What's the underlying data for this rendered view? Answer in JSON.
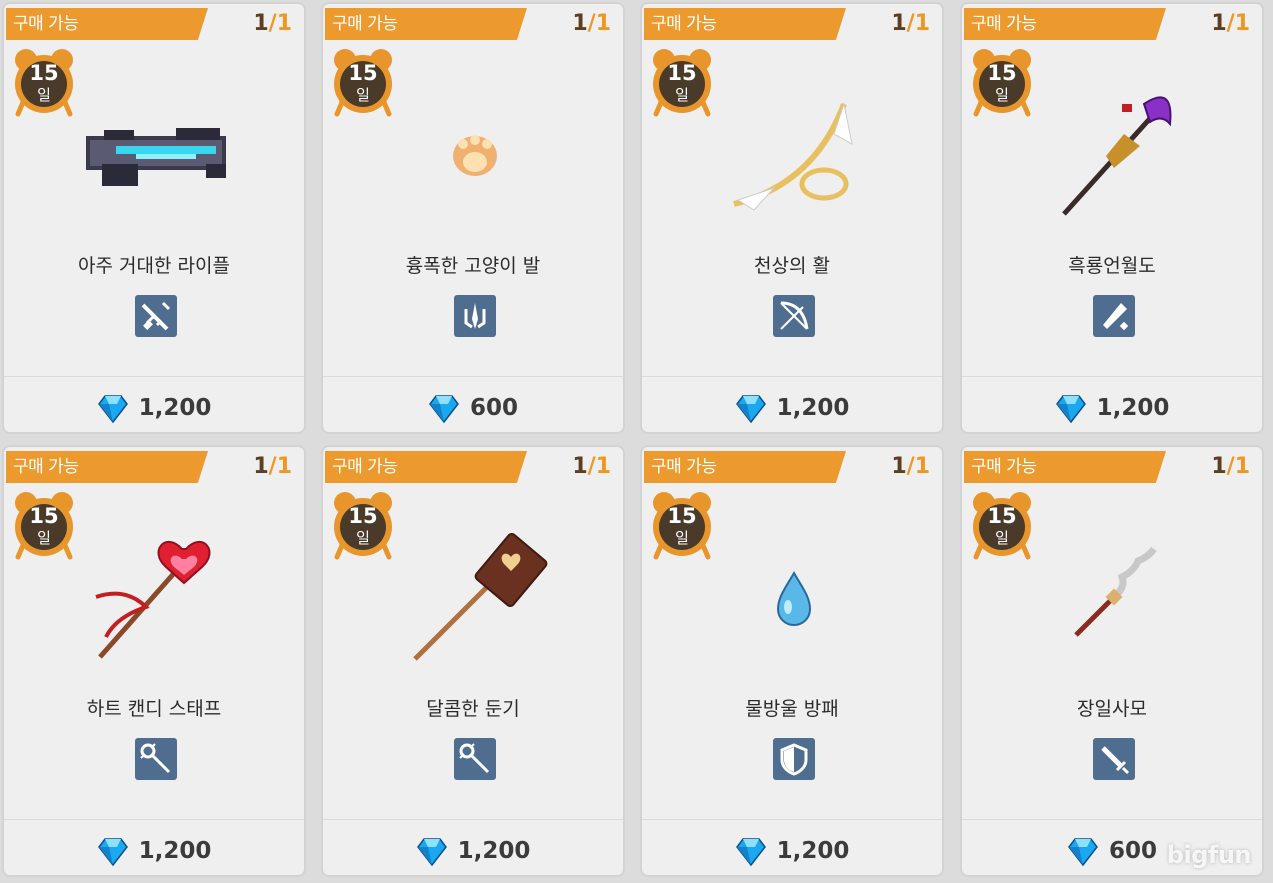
{
  "cards": [
    {
      "tag": "구매 가능",
      "stock": "1",
      "sep": "/",
      "max": "1",
      "days": "15",
      "unit": "일",
      "name": "아주 거대한 라이플",
      "type_icon": "rifle-icon",
      "price": "1,200",
      "item_icon": "giant-rifle-icon"
    },
    {
      "tag": "구매 가능",
      "stock": "1",
      "sep": "/",
      "max": "1",
      "days": "15",
      "unit": "일",
      "name": "흉폭한 고양이 발",
      "type_icon": "claw-icon",
      "price": "600",
      "item_icon": "cat-paw-icon"
    },
    {
      "tag": "구매 가능",
      "stock": "1",
      "sep": "/",
      "max": "1",
      "days": "15",
      "unit": "일",
      "name": "천상의 활",
      "type_icon": "bow-icon",
      "price": "1,200",
      "item_icon": "celestial-bow-icon"
    },
    {
      "tag": "구매 가능",
      "stock": "1",
      "sep": "/",
      "max": "1",
      "days": "15",
      "unit": "일",
      "name": "흑룡언월도",
      "type_icon": "blade-icon",
      "price": "1,200",
      "item_icon": "black-dragon-glaive-icon"
    },
    {
      "tag": "구매 가능",
      "stock": "1",
      "sep": "/",
      "max": "1",
      "days": "15",
      "unit": "일",
      "name": "하트 캔디 스태프",
      "type_icon": "staff-icon",
      "price": "1,200",
      "item_icon": "heart-candy-staff-icon"
    },
    {
      "tag": "구매 가능",
      "stock": "1",
      "sep": "/",
      "max": "1",
      "days": "15",
      "unit": "일",
      "name": "달콤한 둔기",
      "type_icon": "staff-icon",
      "price": "1,200",
      "item_icon": "sweet-mace-icon"
    },
    {
      "tag": "구매 가능",
      "stock": "1",
      "sep": "/",
      "max": "1",
      "days": "15",
      "unit": "일",
      "name": "물방울 방패",
      "type_icon": "shield-icon",
      "price": "1,200",
      "item_icon": "water-drop-shield-icon"
    },
    {
      "tag": "구매 가능",
      "stock": "1",
      "sep": "/",
      "max": "1",
      "days": "15",
      "unit": "일",
      "name": "장일사모",
      "type_icon": "sword-icon",
      "price": "600",
      "item_icon": "serpent-spear-icon"
    }
  ],
  "watermark": "bigfun",
  "colors": {
    "tag": "#ec9a2e",
    "badge": "#e8962c",
    "type_icon_bg": "#4f6e8f",
    "gem": "#1aa8f0"
  }
}
